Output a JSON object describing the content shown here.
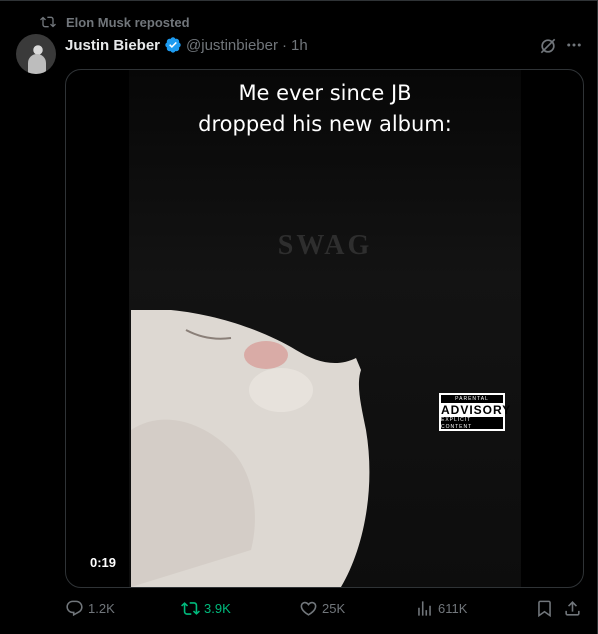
{
  "repost": {
    "text": "Elon Musk reposted"
  },
  "tweet": {
    "name": "Justin Bieber",
    "handle": "@justinbieber",
    "separator": "·",
    "time": "1h"
  },
  "media": {
    "caption_line1": "Me ever since JB",
    "caption_line2": "dropped his new album:",
    "cover_title": "SWAG",
    "advisory_top": "PARENTAL",
    "advisory_main": "ADVISORY",
    "advisory_bottom": "EXPLICIT CONTENT",
    "duration": "0:19"
  },
  "actions": {
    "replies": "1.2K",
    "reposts": "3.9K",
    "likes": "25K",
    "views": "611K"
  },
  "colors": {
    "background": "#000000",
    "muted": "#71767b",
    "repost_active": "#00ba7c",
    "verified": "#1d9bf0"
  }
}
